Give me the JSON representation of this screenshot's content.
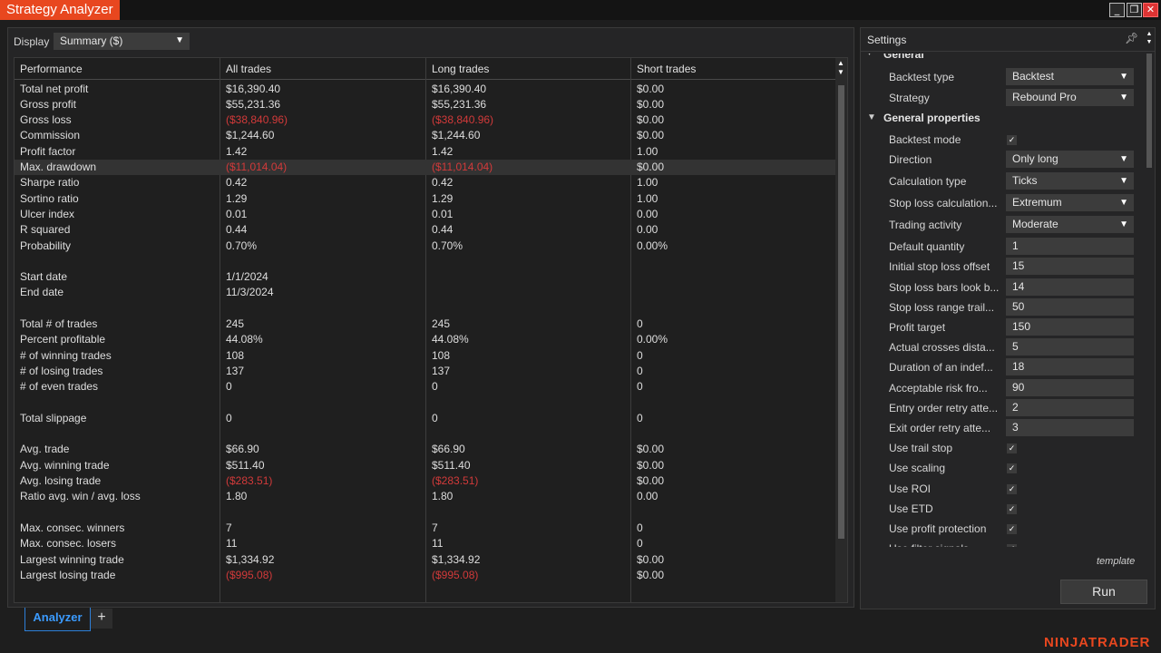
{
  "window": {
    "title": "Strategy Analyzer"
  },
  "analyzer": {
    "display_label": "Display",
    "display_value": "Summary ($)",
    "columns": [
      "Performance",
      "All trades",
      "Long trades",
      "Short trades"
    ],
    "rows": [
      [
        "Total net profit",
        "$16,390.40",
        "$16,390.40",
        "$0.00"
      ],
      [
        "Gross profit",
        "$55,231.36",
        "$55,231.36",
        "$0.00"
      ],
      [
        "Gross loss",
        "($38,840.96)",
        "($38,840.96)",
        "$0.00"
      ],
      [
        "Commission",
        "$1,244.60",
        "$1,244.60",
        "$0.00"
      ],
      [
        "Profit factor",
        "1.42",
        "1.42",
        "1.00"
      ],
      [
        "Max. drawdown",
        "($11,014.04)",
        "($11,014.04)",
        "$0.00"
      ],
      [
        "Sharpe ratio",
        "0.42",
        "0.42",
        "1.00"
      ],
      [
        "Sortino ratio",
        "1.29",
        "1.29",
        "1.00"
      ],
      [
        "Ulcer index",
        "0.01",
        "0.01",
        "0.00"
      ],
      [
        "R squared",
        "0.44",
        "0.44",
        "0.00"
      ],
      [
        "Probability",
        "0.70%",
        "0.70%",
        "0.00%"
      ],
      [
        "",
        "",
        "",
        ""
      ],
      [
        "Start date",
        "1/1/2024",
        "",
        ""
      ],
      [
        "End date",
        "11/3/2024",
        "",
        ""
      ],
      [
        "",
        "",
        "",
        ""
      ],
      [
        "Total # of trades",
        "245",
        "245",
        "0"
      ],
      [
        "Percent profitable",
        "44.08%",
        "44.08%",
        "0.00%"
      ],
      [
        "# of winning trades",
        "108",
        "108",
        "0"
      ],
      [
        "# of losing trades",
        "137",
        "137",
        "0"
      ],
      [
        "# of even trades",
        "0",
        "0",
        "0"
      ],
      [
        "",
        "",
        "",
        ""
      ],
      [
        "Total slippage",
        "0",
        "0",
        "0"
      ],
      [
        "",
        "",
        "",
        ""
      ],
      [
        "Avg. trade",
        "$66.90",
        "$66.90",
        "$0.00"
      ],
      [
        "Avg. winning trade",
        "$511.40",
        "$511.40",
        "$0.00"
      ],
      [
        "Avg. losing trade",
        "($283.51)",
        "($283.51)",
        "$0.00"
      ],
      [
        "Ratio avg. win / avg. loss",
        "1.80",
        "1.80",
        "0.00"
      ],
      [
        "",
        "",
        "",
        ""
      ],
      [
        "Max. consec. winners",
        "7",
        "7",
        "0"
      ],
      [
        "Max. consec. losers",
        "11",
        "11",
        "0"
      ],
      [
        "Largest winning trade",
        "$1,334.92",
        "$1,334.92",
        "$0.00"
      ],
      [
        "Largest losing trade",
        "($995.08)",
        "($995.08)",
        "$0.00"
      ]
    ],
    "highlighted_row": "Max. drawdown"
  },
  "tabs": {
    "active": "Analyzer",
    "add": "+"
  },
  "settings": {
    "title": "Settings",
    "partial_section": "General",
    "general_props": [
      {
        "label": "Backtest type",
        "value": "Backtest",
        "kind": "select"
      },
      {
        "label": "Strategy",
        "value": "Rebound Pro",
        "kind": "select"
      }
    ],
    "section": "General properties",
    "props": [
      {
        "label": "Backtest mode",
        "kind": "check",
        "checked": true
      },
      {
        "label": "Direction",
        "value": "Only long",
        "kind": "select"
      },
      {
        "label": "Calculation type",
        "value": "Ticks",
        "kind": "select"
      },
      {
        "label": "Stop loss calculation...",
        "value": "Extremum",
        "kind": "select"
      },
      {
        "label": "Trading activity",
        "value": "Moderate",
        "kind": "select"
      },
      {
        "label": "Default quantity",
        "value": "1",
        "kind": "text"
      },
      {
        "label": "Initial stop loss offset",
        "value": "15",
        "kind": "text"
      },
      {
        "label": "Stop loss bars look b...",
        "value": "14",
        "kind": "text"
      },
      {
        "label": "Stop loss range trail...",
        "value": "50",
        "kind": "text"
      },
      {
        "label": "Profit target",
        "value": "150",
        "kind": "text"
      },
      {
        "label": "Actual crosses dista...",
        "value": "5",
        "kind": "text"
      },
      {
        "label": "Duration of an indef...",
        "value": "18",
        "kind": "text"
      },
      {
        "label": "Acceptable risk fro...",
        "value": "90",
        "kind": "text"
      },
      {
        "label": "Entry order retry atte...",
        "value": "2",
        "kind": "text"
      },
      {
        "label": "Exit order retry atte...",
        "value": "3",
        "kind": "text"
      },
      {
        "label": "Use trail stop",
        "kind": "check",
        "checked": true
      },
      {
        "label": "Use scaling",
        "kind": "check",
        "checked": true
      },
      {
        "label": "Use ROI",
        "kind": "check",
        "checked": true
      },
      {
        "label": "Use ETD",
        "kind": "check",
        "checked": true
      },
      {
        "label": "Use profit protection",
        "kind": "check",
        "checked": true
      },
      {
        "label": "Use filter signals",
        "kind": "check",
        "checked": true
      }
    ],
    "template_label": "template",
    "run_label": "Run"
  },
  "brand": "NINJATRADER",
  "colors": {
    "accent": "#e8471f",
    "negative": "#d23a3a",
    "tab_active": "#3b9bff"
  }
}
